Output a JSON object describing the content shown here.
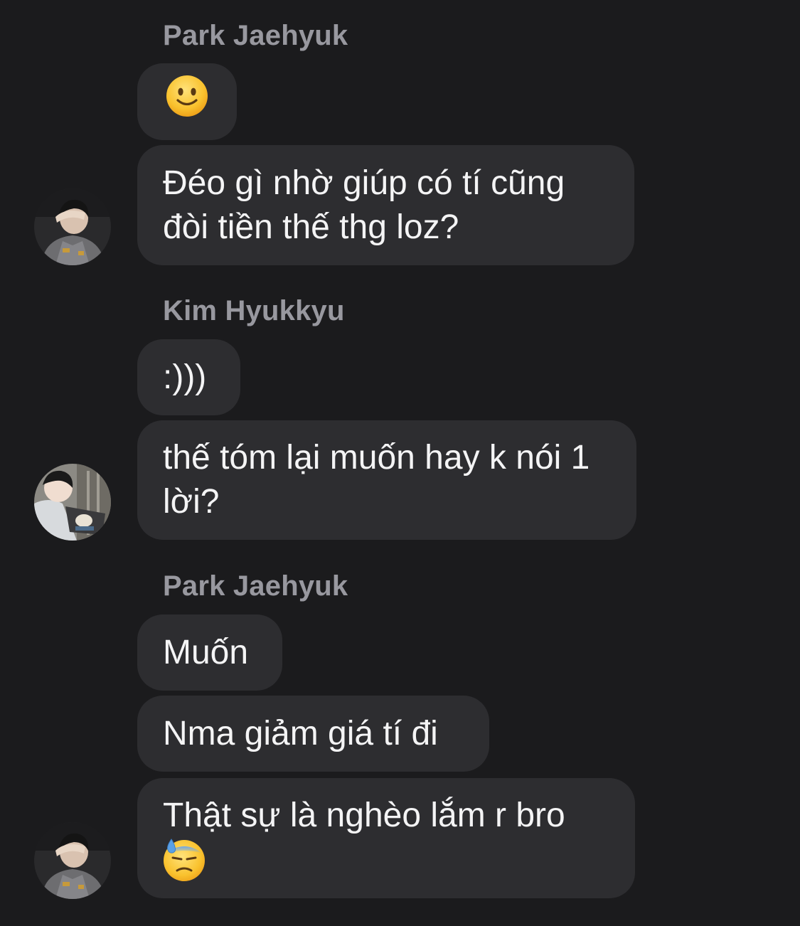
{
  "conversation": {
    "groups": [
      {
        "sender": "Park Jaehyuk",
        "avatar_icon": "avatar-park-jaehyuk",
        "messages": [
          {
            "text": "",
            "emoji": "slightly-smiling-face-icon"
          },
          {
            "text": "Đéo gì nhờ giúp có tí cũng đòi tiền thế thg loz?"
          }
        ]
      },
      {
        "sender": "Kim Hyukkyu",
        "avatar_icon": "avatar-kim-hyukkyu",
        "messages": [
          {
            "text": ":)))"
          },
          {
            "text": "thế tóm lại muốn hay k nói 1 lời?"
          }
        ]
      },
      {
        "sender": "Park Jaehyuk",
        "avatar_icon": "avatar-park-jaehyuk",
        "messages": [
          {
            "text": "Muốn"
          },
          {
            "text": "Nma giảm giá tí đi"
          },
          {
            "text": "Thật sự là nghèo lắm r bro",
            "emoji": "downcast-face-with-sweat-icon"
          }
        ]
      }
    ]
  },
  "colors": {
    "background": "#1b1b1d",
    "bubble": "#2d2d30",
    "sender_name": "#98989f",
    "message_text": "#f4f4f5"
  }
}
